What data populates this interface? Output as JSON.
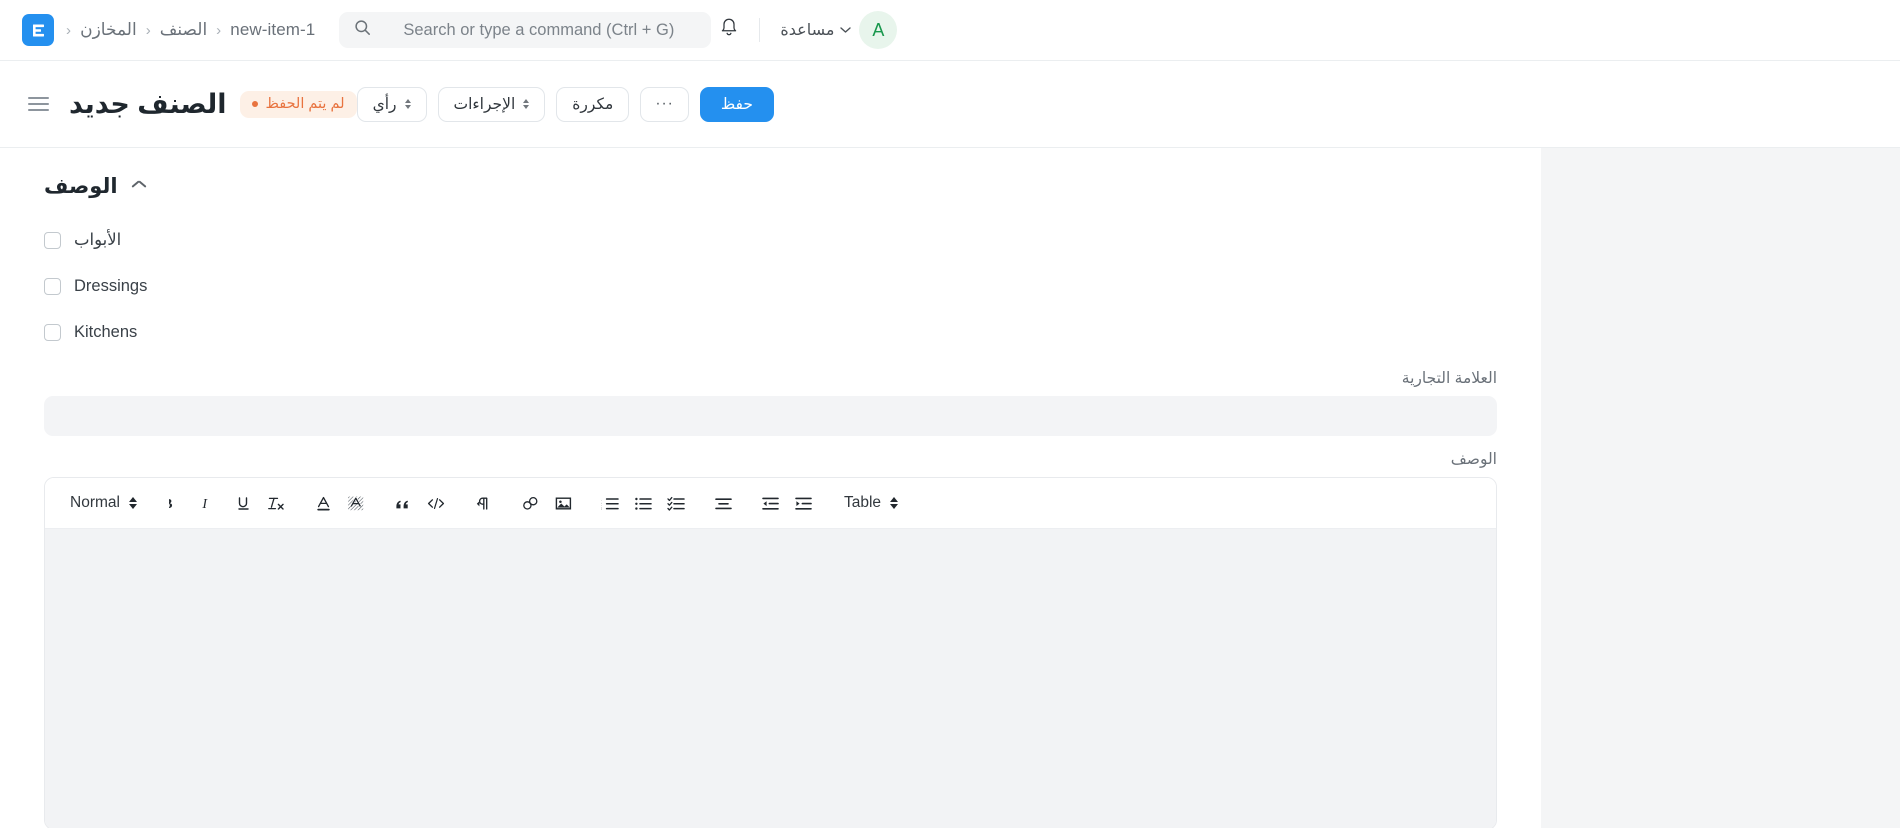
{
  "navbar": {
    "logo_icon": "erpnext-logo-icon",
    "breadcrumbs": [
      {
        "label": "المخازن",
        "icon": ""
      },
      {
        "label": "الصنف",
        "icon": ""
      },
      {
        "label": "new-item-1",
        "icon": ""
      }
    ],
    "breadcrumb_separator": "‹",
    "search": {
      "placeholder": "Search or type a command (Ctrl + G)",
      "value": "",
      "icon": "search-icon"
    },
    "notifications_icon": "bell-icon",
    "help_label": "مساعدة",
    "help_caret_icon": "chevron-down-icon",
    "avatar_initial": "A"
  },
  "page_head": {
    "menu_icon": "hamburger-menu-icon",
    "title": "الصنف جديد",
    "status_badge": "لم يتم الحفظ",
    "actions": [
      {
        "name": "view-button",
        "label": "رأي",
        "has_caret": true
      },
      {
        "name": "actions-button",
        "label": "الإجراءات",
        "has_caret": true
      },
      {
        "name": "duplicate-button",
        "label": "مكررة",
        "has_caret": false
      },
      {
        "name": "more-button",
        "label": "···",
        "has_caret": false
      }
    ],
    "save_label": "حفظ"
  },
  "form": {
    "section_title": "الوصف",
    "section_collapse_icon": "chevron-up-icon",
    "checkboxes": [
      {
        "label": "الأبواب",
        "checked": false
      },
      {
        "label": "Dressings",
        "checked": false
      },
      {
        "label": "Kitchens",
        "checked": false
      }
    ],
    "brand": {
      "label": "العلامة التجارية",
      "value": "",
      "placeholder": ""
    },
    "description": {
      "label": "الوصف",
      "value": ""
    }
  },
  "editor_toolbar": {
    "style_select": "Normal",
    "table_select": "Table",
    "buttons": [
      {
        "name": "bold-button",
        "icon": "bold-icon",
        "label": "B"
      },
      {
        "name": "italic-button",
        "icon": "italic-icon",
        "label": "I"
      },
      {
        "name": "underline-button",
        "icon": "underline-icon",
        "label": "U"
      },
      {
        "name": "clear-format-button",
        "icon": "clear-format-icon",
        "label": "Tx"
      },
      {
        "name": "text-color-button",
        "icon": "text-color-icon",
        "label": "A"
      },
      {
        "name": "highlight-button",
        "icon": "highlight-icon",
        "label": "A"
      },
      {
        "name": "blockquote-button",
        "icon": "quote-icon",
        "label": "”"
      },
      {
        "name": "code-button",
        "icon": "code-icon",
        "label": "</>"
      },
      {
        "name": "text-direction-button",
        "icon": "text-direction-rtl-icon",
        "label": "¶"
      },
      {
        "name": "link-button",
        "icon": "link-icon",
        "label": ""
      },
      {
        "name": "image-button",
        "icon": "image-icon",
        "label": ""
      },
      {
        "name": "ordered-list-button",
        "icon": "ordered-list-icon",
        "label": ""
      },
      {
        "name": "bullet-list-button",
        "icon": "bullet-list-icon",
        "label": ""
      },
      {
        "name": "checklist-button",
        "icon": "checklist-icon",
        "label": ""
      },
      {
        "name": "align-button",
        "icon": "align-icon",
        "label": ""
      },
      {
        "name": "outdent-button",
        "icon": "outdent-icon",
        "label": ""
      },
      {
        "name": "indent-button",
        "icon": "indent-icon",
        "label": ""
      }
    ]
  },
  "colors": {
    "accent": "#2490ef",
    "warning": "#e8733f",
    "warning_bg": "#fdf0e6",
    "avatar_bg": "#e8f5ec",
    "avatar_fg": "#18974c",
    "page_bg": "#f4f5f6",
    "field_bg": "#f3f4f6"
  }
}
